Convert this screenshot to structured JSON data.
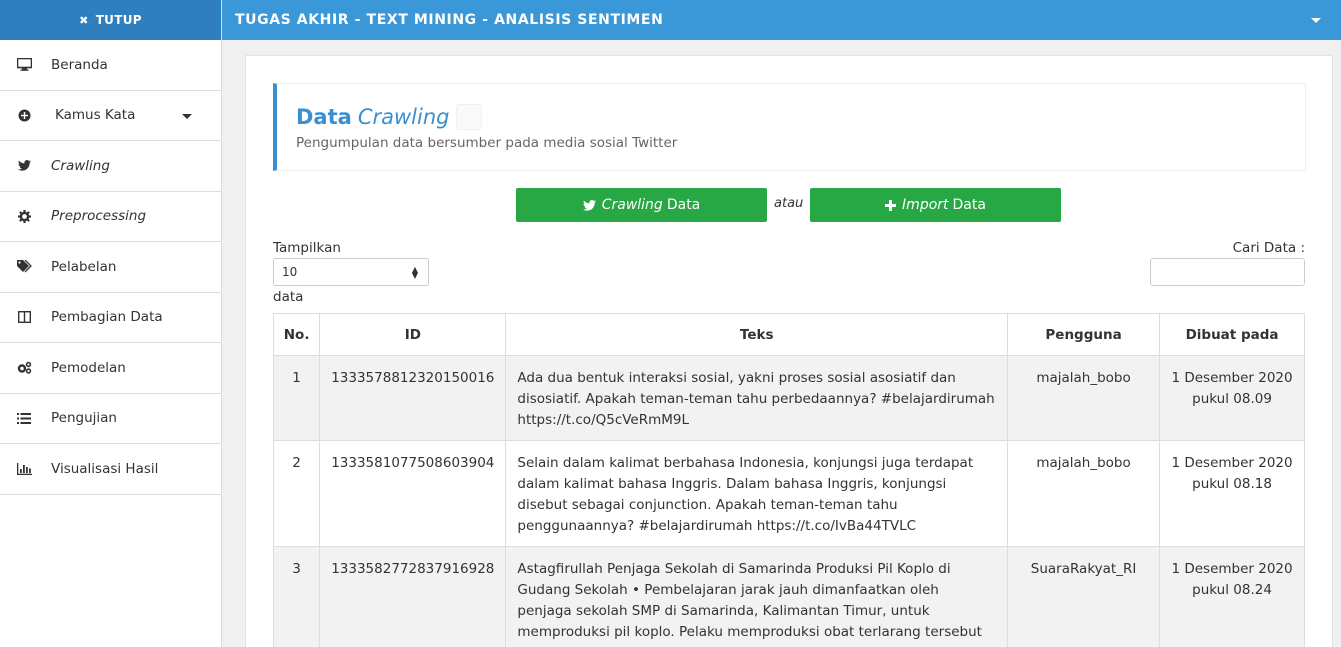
{
  "sidebar": {
    "close_label": "TUTUP",
    "items": [
      {
        "label": "Beranda",
        "icon": "desktop-icon",
        "italic": false
      },
      {
        "label": "Kamus Kata",
        "icon": "plus-circle-icon",
        "italic": false
      },
      {
        "label": "Crawling",
        "icon": "twitter-icon",
        "italic": true
      },
      {
        "label": "Preprocessing",
        "icon": "gear-icon",
        "italic": true
      },
      {
        "label": "Pelabelan",
        "icon": "tags-icon",
        "italic": false
      },
      {
        "label": "Pembagian Data",
        "icon": "columns-icon",
        "italic": false
      },
      {
        "label": "Pemodelan",
        "icon": "gears-icon",
        "italic": false
      },
      {
        "label": "Pengujian",
        "icon": "list-icon",
        "italic": false
      },
      {
        "label": "Visualisasi Hasil",
        "icon": "bar-chart-icon",
        "italic": false
      }
    ]
  },
  "topbar": {
    "title": "TUGAS AKHIR - TEXT MINING - ANALISIS SENTIMEN"
  },
  "header": {
    "title_bold": "Data",
    "title_italic": "Crawling",
    "subtitle": "Pengumpulan data bersumber pada media sosial Twitter"
  },
  "actions": {
    "crawl_italic": "Crawling",
    "crawl_rest": "Data",
    "or_label": "atau",
    "import_italic": "Import",
    "import_rest": "Data"
  },
  "controls": {
    "show_label": "Tampilkan",
    "show_value": "10",
    "show_suffix": "data",
    "search_label": "Cari Data :",
    "search_value": ""
  },
  "table": {
    "headers": [
      "No.",
      "ID",
      "Teks",
      "Pengguna",
      "Dibuat pada"
    ],
    "rows": [
      {
        "no": "1",
        "id": "1333578812320150016",
        "text": "Ada dua bentuk interaksi sosial, yakni proses sosial asosiatif dan disosiatif. Apakah teman-teman tahu perbedaannya? #belajardirumah https://t.co/Q5cVeRmM9L",
        "user": "majalah_bobo",
        "date": "1 Desember 2020",
        "time": "pukul 08.09"
      },
      {
        "no": "2",
        "id": "1333581077508603904",
        "text": "Selain dalam kalimat berbahasa Indonesia, konjungsi juga terdapat dalam kalimat bahasa Inggris. Dalam bahasa Inggris, konjungsi disebut sebagai conjunction. Apakah teman-teman tahu penggunaannya? #belajardirumah https://t.co/IvBa44TVLC",
        "user": "majalah_bobo",
        "date": "1 Desember 2020",
        "time": "pukul 08.18"
      },
      {
        "no": "3",
        "id": "1333582772837916928",
        "text": "Astagfirullah Penjaga Sekolah di Samarinda Produksi Pil Koplo di Gudang Sekolah • Pembelajaran jarak jauh dimanfaatkan oleh penjaga sekolah SMP di Samarinda, Kalimantan Timur, untuk memproduksi pil koplo. Pelaku memproduksi obat terlarang tersebut di guda",
        "user": "SuaraRakyat_RI",
        "date": "1 Desember 2020",
        "time": "pukul 08.24"
      }
    ]
  },
  "colors": {
    "topbar": "#3a97d8",
    "close_bar": "#2f7ebd",
    "accent": "#3a8fd0",
    "button": "#28a745"
  }
}
